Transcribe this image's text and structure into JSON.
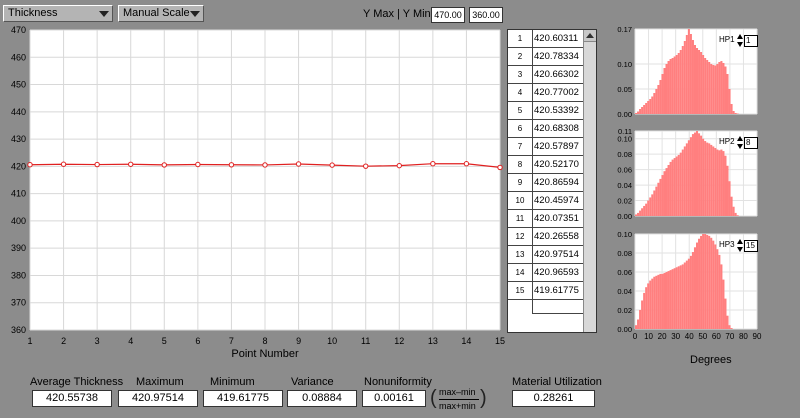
{
  "toolbar": {
    "measure_select": "Thickness",
    "scale_select": "Manual Scale",
    "ymax_ymin_label": "Y Max | Y Min",
    "ymax_value": "470.00",
    "ymin_value": "360.00"
  },
  "colors": {
    "series": "#e02020",
    "histogram": "#ff7f7f",
    "panel": "#ffffff",
    "background": "#8c8c8c"
  },
  "chart_data": [
    {
      "type": "line",
      "xlabel": "Point Number",
      "ylabel": "",
      "xlim": [
        1,
        15
      ],
      "ylim": [
        360,
        470
      ],
      "x_ticks": [
        "1",
        "2",
        "3",
        "4",
        "5",
        "6",
        "7",
        "8",
        "9",
        "10",
        "11",
        "12",
        "13",
        "14",
        "15"
      ],
      "y_ticks": [
        "470",
        "460",
        "450",
        "440",
        "430",
        "420",
        "410",
        "400",
        "390",
        "380",
        "370",
        "360"
      ],
      "grid": true,
      "series": [
        {
          "x": [
            1,
            2,
            3,
            4,
            5,
            6,
            7,
            8,
            9,
            10,
            11,
            12,
            13,
            14,
            15
          ],
          "values": [
            420.60311,
            420.78334,
            420.66302,
            420.77002,
            420.53392,
            420.68308,
            420.57897,
            420.5217,
            420.86594,
            420.45974,
            420.07351,
            420.26558,
            420.97514,
            420.96593,
            419.61775
          ]
        }
      ]
    },
    {
      "type": "bar",
      "name": "HP1",
      "xlim": [
        0,
        90
      ],
      "ylim": [
        0,
        0.17
      ],
      "y_ticks": [
        "0.17",
        "0.10",
        "0.05",
        "0.00"
      ],
      "values": [
        0.002,
        0.005,
        0.01,
        0.014,
        0.018,
        0.022,
        0.026,
        0.03,
        0.035,
        0.042,
        0.05,
        0.058,
        0.068,
        0.08,
        0.092,
        0.1,
        0.106,
        0.11,
        0.112,
        0.115,
        0.118,
        0.122,
        0.128,
        0.136,
        0.146,
        0.158,
        0.17,
        0.16,
        0.148,
        0.138,
        0.132,
        0.128,
        0.124,
        0.118,
        0.112,
        0.108,
        0.104,
        0.1,
        0.098,
        0.097,
        0.1,
        0.104,
        0.106,
        0.102,
        0.095,
        0.08,
        0.05,
        0.02,
        0.006,
        0.002,
        0.001
      ]
    },
    {
      "type": "bar",
      "name": "HP2",
      "xlim": [
        0,
        90
      ],
      "ylim": [
        0,
        0.11
      ],
      "y_ticks": [
        "0.11",
        "0.10",
        "0.08",
        "0.06",
        "0.04",
        "0.02",
        "0.00"
      ],
      "values": [
        0.002,
        0.004,
        0.007,
        0.01,
        0.013,
        0.016,
        0.02,
        0.024,
        0.028,
        0.033,
        0.038,
        0.043,
        0.048,
        0.053,
        0.058,
        0.062,
        0.066,
        0.07,
        0.073,
        0.075,
        0.077,
        0.079,
        0.082,
        0.086,
        0.09,
        0.094,
        0.098,
        0.102,
        0.106,
        0.108,
        0.11,
        0.107,
        0.104,
        0.1,
        0.097,
        0.095,
        0.094,
        0.092,
        0.09,
        0.088,
        0.086,
        0.085,
        0.086,
        0.084,
        0.078,
        0.065,
        0.045,
        0.025,
        0.012,
        0.004,
        0.001
      ]
    },
    {
      "type": "bar",
      "name": "HP3",
      "xlim": [
        0,
        90
      ],
      "ylim": [
        0,
        0.1
      ],
      "y_ticks": [
        "0.10",
        "0.08",
        "0.06",
        "0.04",
        "0.02",
        "0.00"
      ],
      "x_ticks": [
        "0",
        "10",
        "20",
        "30",
        "40",
        "50",
        "60",
        "70",
        "80",
        "90"
      ],
      "xlabel": "Degrees",
      "values": [
        0.004,
        0.01,
        0.02,
        0.03,
        0.038,
        0.044,
        0.048,
        0.051,
        0.053,
        0.055,
        0.056,
        0.057,
        0.058,
        0.058,
        0.059,
        0.06,
        0.061,
        0.062,
        0.063,
        0.064,
        0.065,
        0.066,
        0.067,
        0.068,
        0.07,
        0.072,
        0.074,
        0.077,
        0.081,
        0.086,
        0.091,
        0.095,
        0.098,
        0.1,
        0.1,
        0.099,
        0.098,
        0.096,
        0.093,
        0.089,
        0.084,
        0.078,
        0.068,
        0.052,
        0.032,
        0.014,
        0.004,
        0.001,
        0,
        0,
        0
      ]
    }
  ],
  "hp_controls": [
    {
      "name": "HP1",
      "value": "1"
    },
    {
      "name": "HP2",
      "value": "8"
    },
    {
      "name": "HP3",
      "value": "15"
    }
  ],
  "table": {
    "rows": [
      {
        "index": "1",
        "value": "420.60311"
      },
      {
        "index": "2",
        "value": "420.78334"
      },
      {
        "index": "3",
        "value": "420.66302"
      },
      {
        "index": "4",
        "value": "420.77002"
      },
      {
        "index": "5",
        "value": "420.53392"
      },
      {
        "index": "6",
        "value": "420.68308"
      },
      {
        "index": "7",
        "value": "420.57897"
      },
      {
        "index": "8",
        "value": "420.52170"
      },
      {
        "index": "9",
        "value": "420.86594"
      },
      {
        "index": "10",
        "value": "420.45974"
      },
      {
        "index": "11",
        "value": "420.07351"
      },
      {
        "index": "12",
        "value": "420.26558"
      },
      {
        "index": "13",
        "value": "420.97514"
      },
      {
        "index": "14",
        "value": "420.96593"
      },
      {
        "index": "15",
        "value": "419.61775"
      }
    ]
  },
  "stats": {
    "avg_label": "Average Thickness",
    "avg_value": "420.55738",
    "max_label": "Maximum",
    "max_value": "420.97514",
    "min_label": "Minimum",
    "min_value": "419.61775",
    "var_label": "Variance",
    "var_value": "0.08884",
    "nonu_label": "Nonuniformity",
    "nonu_value": "0.00161",
    "formula_num": "max–min",
    "formula_den": "max+min",
    "util_label": "Material Utilization",
    "util_value": "0.28261"
  }
}
